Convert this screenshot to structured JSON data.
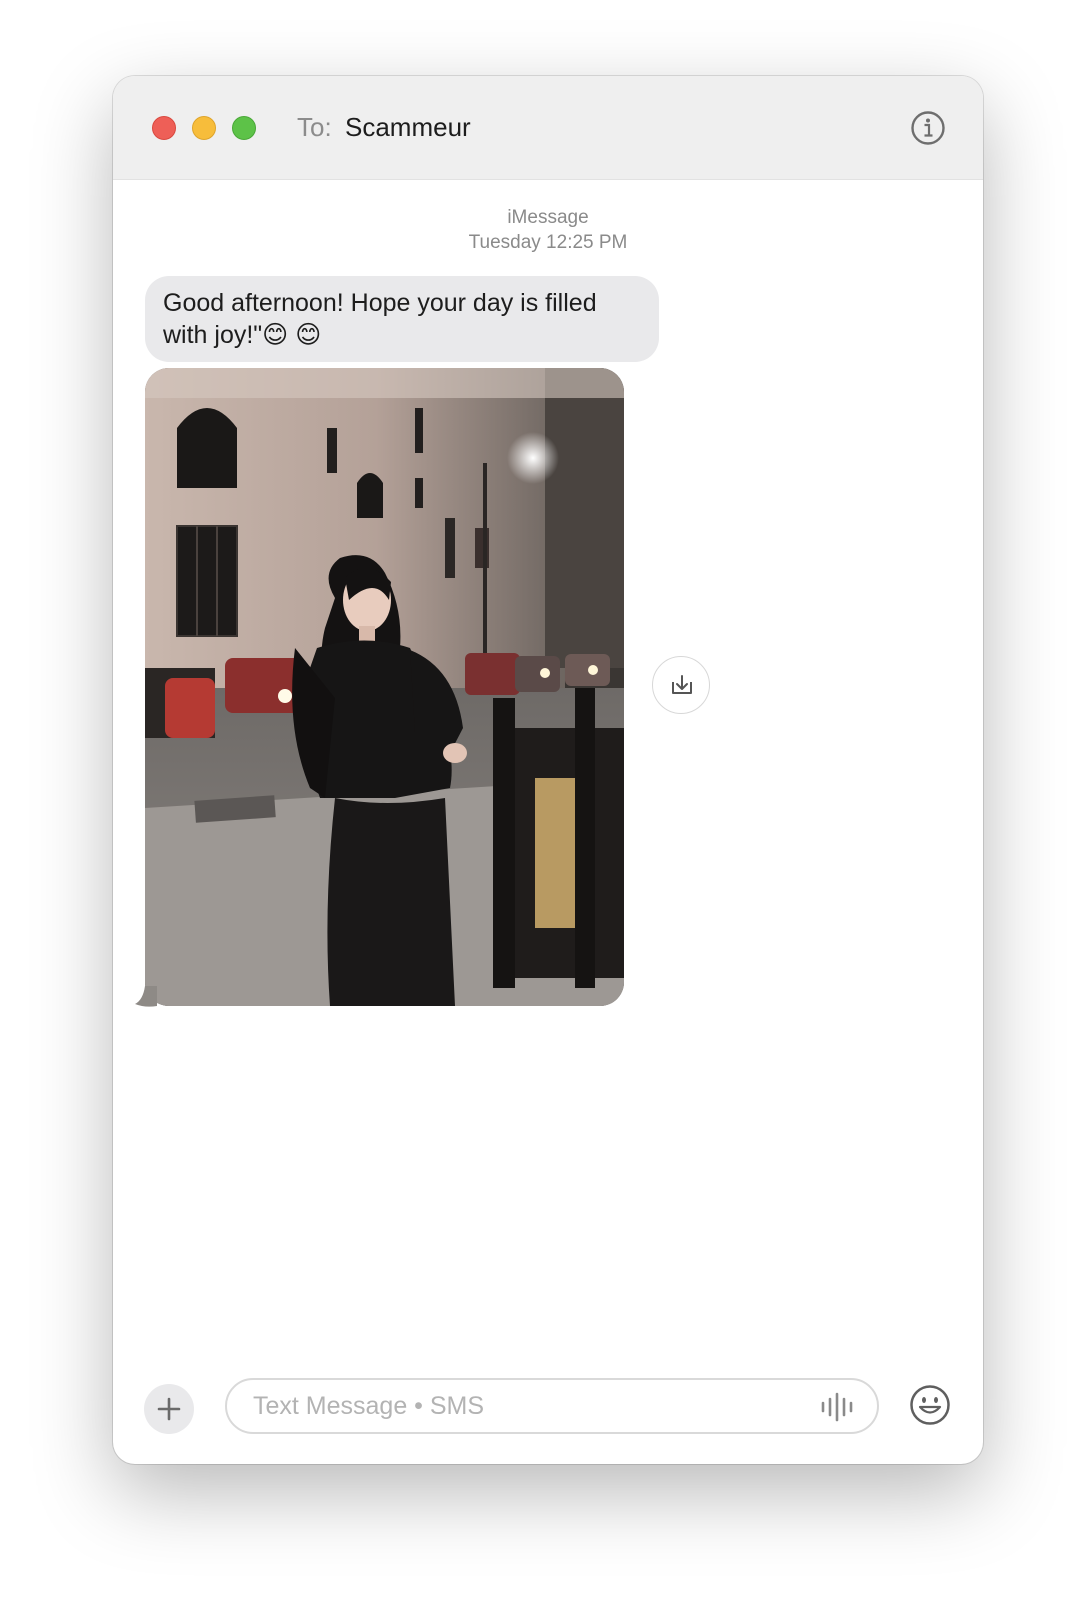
{
  "header": {
    "to_label": "To:",
    "recipient": "Scammeur",
    "info_icon": "info-icon"
  },
  "conversation": {
    "service": "iMessage",
    "timestamp": "Tuesday 12:25 PM",
    "messages": [
      {
        "type": "text",
        "direction": "incoming",
        "text": "Good afternoon! Hope your day is filled with joy!\"😊 😊"
      },
      {
        "type": "image",
        "direction": "incoming",
        "save_icon": "save-to-downloads-icon"
      }
    ]
  },
  "composer": {
    "add_icon": "plus-icon",
    "placeholder": "Text Message • SMS",
    "audio_icon": "audio-waveform-icon",
    "emoji_icon": "emoji-icon"
  },
  "colors": {
    "close": "#ee5f57",
    "minimize": "#f7bd3b",
    "zoom": "#5dc248",
    "incoming_bubble": "#e9e9eb",
    "titlebar": "#efefef"
  }
}
